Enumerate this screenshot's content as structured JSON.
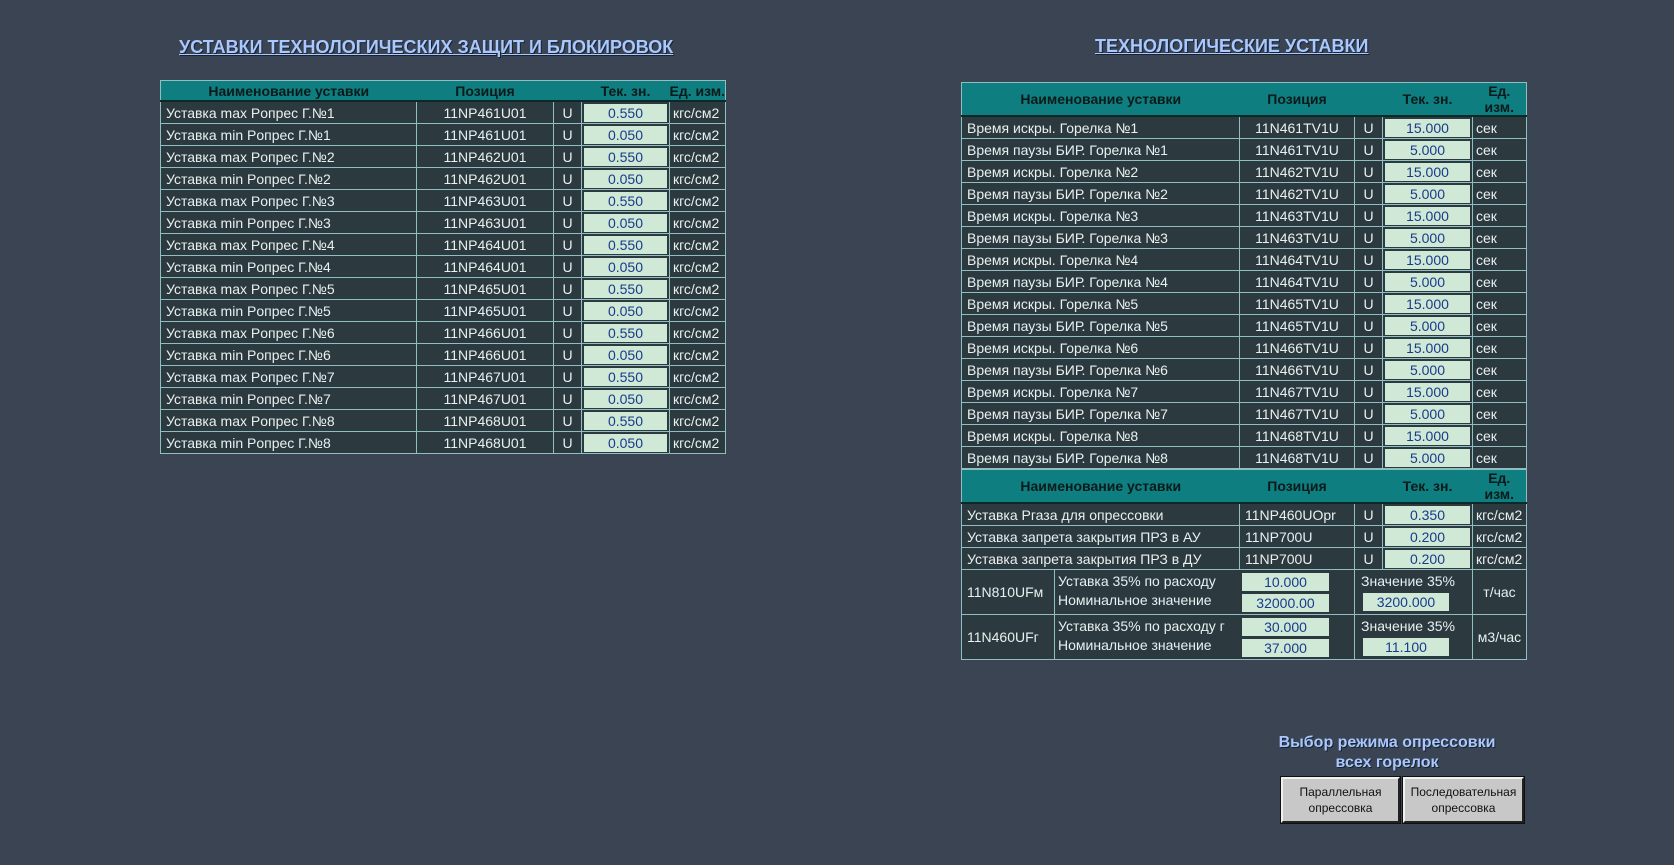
{
  "left": {
    "title": "УСТАВКИ ТЕХНОЛОГИЧЕСКИХ ЗАЩИТ И БЛОКИРОВОК",
    "headers": [
      "Наименование уставки",
      "Позиция",
      "Тек. зн.",
      "Ед. изм."
    ],
    "rows": [
      {
        "name": "Уставка max Pопрес Г.№1",
        "pos": "11NP461U01",
        "u": "U",
        "value": "0.550",
        "unit": "кгс/см2"
      },
      {
        "name": "Уставка min Pопрес Г.№1",
        "pos": "11NP461U01",
        "u": "U",
        "value": "0.050",
        "unit": "кгс/см2"
      },
      {
        "name": "Уставка max Pопрес Г.№2",
        "pos": "11NP462U01",
        "u": "U",
        "value": "0.550",
        "unit": "кгс/см2"
      },
      {
        "name": "Уставка min Pопрес Г.№2",
        "pos": "11NP462U01",
        "u": "U",
        "value": "0.050",
        "unit": "кгс/см2"
      },
      {
        "name": "Уставка max Pопрес Г.№3",
        "pos": "11NP463U01",
        "u": "U",
        "value": "0.550",
        "unit": "кгс/см2"
      },
      {
        "name": "Уставка min Pопрес Г.№3",
        "pos": "11NP463U01",
        "u": "U",
        "value": "0.050",
        "unit": "кгс/см2"
      },
      {
        "name": "Уставка max Pопрес Г.№4",
        "pos": "11NP464U01",
        "u": "U",
        "value": "0.550",
        "unit": "кгс/см2"
      },
      {
        "name": "Уставка min Pопрес Г.№4",
        "pos": "11NP464U01",
        "u": "U",
        "value": "0.050",
        "unit": "кгс/см2"
      },
      {
        "name": "Уставка max Pопрес Г.№5",
        "pos": "11NP465U01",
        "u": "U",
        "value": "0.550",
        "unit": "кгс/см2"
      },
      {
        "name": "Уставка min Pопрес Г.№5",
        "pos": "11NP465U01",
        "u": "U",
        "value": "0.050",
        "unit": "кгс/см2"
      },
      {
        "name": "Уставка max Pопрес Г.№6",
        "pos": "11NP466U01",
        "u": "U",
        "value": "0.550",
        "unit": "кгс/см2"
      },
      {
        "name": "Уставка min Pопрес Г.№6",
        "pos": "11NP466U01",
        "u": "U",
        "value": "0.050",
        "unit": "кгс/см2"
      },
      {
        "name": "Уставка max Pопрес Г.№7",
        "pos": "11NP467U01",
        "u": "U",
        "value": "0.550",
        "unit": "кгс/см2"
      },
      {
        "name": "Уставка min Pопрес Г.№7",
        "pos": "11NP467U01",
        "u": "U",
        "value": "0.050",
        "unit": "кгс/см2"
      },
      {
        "name": "Уставка max Pопрес Г.№8",
        "pos": "11NP468U01",
        "u": "U",
        "value": "0.550",
        "unit": "кгс/см2"
      },
      {
        "name": "Уставка min Pопрес Г.№8",
        "pos": "11NP468U01",
        "u": "U",
        "value": "0.050",
        "unit": "кгс/см2"
      }
    ]
  },
  "right": {
    "title": "ТЕХНОЛОГИЧЕСКИЕ УСТАВКИ",
    "headers": [
      "Наименование уставки",
      "Позиция",
      "Тек. зн.",
      "Ед. изм."
    ],
    "rows": [
      {
        "name": "Время искры. Горелка №1",
        "pos": "11N461TV1U",
        "u": "U",
        "value": "15.000",
        "unit": "сек"
      },
      {
        "name": "Время паузы БИР. Горелка №1",
        "pos": "11N461TV1U",
        "u": "U",
        "value": "5.000",
        "unit": "сек"
      },
      {
        "name": "Время искры. Горелка №2",
        "pos": "11N462TV1U",
        "u": "U",
        "value": "15.000",
        "unit": "сек"
      },
      {
        "name": "Время паузы БИР. Горелка №2",
        "pos": "11N462TV1U",
        "u": "U",
        "value": "5.000",
        "unit": "сек"
      },
      {
        "name": "Время искры. Горелка №3",
        "pos": "11N463TV1U",
        "u": "U",
        "value": "15.000",
        "unit": "сек"
      },
      {
        "name": "Время паузы БИР. Горелка №3",
        "pos": "11N463TV1U",
        "u": "U",
        "value": "5.000",
        "unit": "сек"
      },
      {
        "name": "Время искры. Горелка №4",
        "pos": "11N464TV1U",
        "u": "U",
        "value": "15.000",
        "unit": "сек"
      },
      {
        "name": "Время паузы БИР. Горелка №4",
        "pos": "11N464TV1U",
        "u": "U",
        "value": "5.000",
        "unit": "сек"
      },
      {
        "name": "Время искры. Горелка №5",
        "pos": "11N465TV1U",
        "u": "U",
        "value": "15.000",
        "unit": "сек"
      },
      {
        "name": "Время паузы БИР. Горелка №5",
        "pos": "11N465TV1U",
        "u": "U",
        "value": "5.000",
        "unit": "сек"
      },
      {
        "name": "Время искры. Горелка №6",
        "pos": "11N466TV1U",
        "u": "U",
        "value": "15.000",
        "unit": "сек"
      },
      {
        "name": "Время паузы БИР. Горелка №6",
        "pos": "11N466TV1U",
        "u": "U",
        "value": "5.000",
        "unit": "сек"
      },
      {
        "name": "Время искры. Горелка №7",
        "pos": "11N467TV1U",
        "u": "U",
        "value": "15.000",
        "unit": "сек"
      },
      {
        "name": "Время паузы БИР. Горелка №7",
        "pos": "11N467TV1U",
        "u": "U",
        "value": "5.000",
        "unit": "сек"
      },
      {
        "name": "Время искры. Горелка №8",
        "pos": "11N468TV1U",
        "u": "U",
        "value": "15.000",
        "unit": "сек"
      },
      {
        "name": "Время паузы БИР. Горелка №8",
        "pos": "11N468TV1U",
        "u": "U",
        "value": "5.000",
        "unit": "сек"
      }
    ]
  },
  "bottom": {
    "headers": [
      "Наименование уставки",
      "Позиция",
      "Тек. зн.",
      "Ед. изм."
    ],
    "rows": [
      {
        "name": "Уставка Pгаза для опрессовки",
        "pos": "11NP460UOpr",
        "u": "U",
        "value": "0.350",
        "unit": "кгс/см2"
      },
      {
        "name": "Уставка запрета закрытия ПРЗ в АУ",
        "pos": "11NP700U",
        "u": "U",
        "value": "0.200",
        "unit": "кгс/см2"
      },
      {
        "name": "Уставка запрета закрытия ПРЗ в ДУ",
        "pos": "11NP700U",
        "u": "U",
        "value": "0.200",
        "unit": "кгс/см2"
      }
    ],
    "flow": [
      {
        "pos": "11N810UFм",
        "label1": "Уставка 35% по расходу",
        "value1": "10.000",
        "label2": "Номинальное значение",
        "value2": "32000.00",
        "label3": "Значение 35%",
        "value3": "3200.000",
        "unit": "т/час"
      },
      {
        "pos": "11N460UFг",
        "label1": "Уставка 35% по расходу г",
        "value1": "30.000",
        "label2": "Номинальное значение",
        "value2": "37.000",
        "label3": "Значение 35%",
        "value3": "11.100",
        "unit": "м3/час"
      }
    ]
  },
  "mode": {
    "title_line1": "Выбор режима опрессовки",
    "title_line2": "всех горелок",
    "parallel_line1": "Параллельная",
    "parallel_line2": "опрессовка",
    "sequential_line1": "Последовательная",
    "sequential_line2": "опрессовка"
  }
}
